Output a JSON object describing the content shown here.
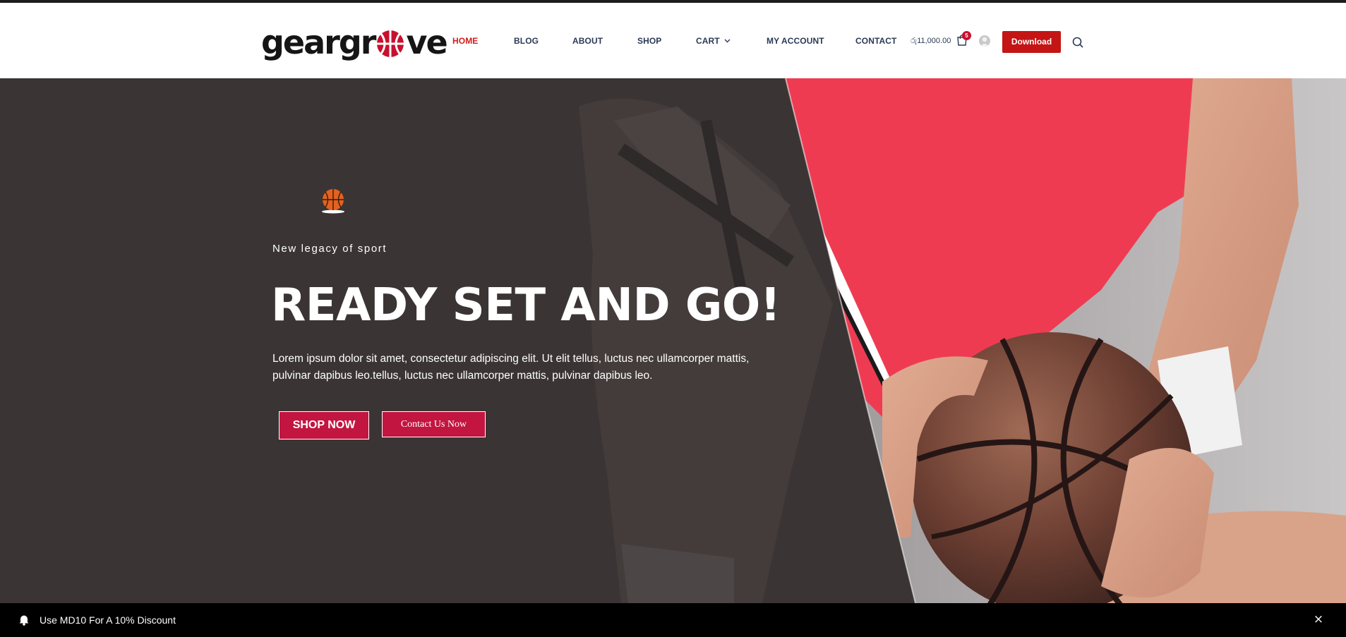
{
  "brand": {
    "logo_prefix": "geargr",
    "logo_suffix": "ve",
    "logo_full": "geargroove"
  },
  "nav": {
    "items": [
      {
        "label": "HOME",
        "active": true
      },
      {
        "label": "BLOG",
        "active": false
      },
      {
        "label": "ABOUT",
        "active": false
      },
      {
        "label": "SHOP",
        "active": false
      },
      {
        "label": "CART",
        "active": false,
        "has_dropdown": true
      },
      {
        "label": "MY ACCOUNT",
        "active": false
      },
      {
        "label": "CONTACT",
        "active": false
      }
    ]
  },
  "header": {
    "cart_total": "රු11,000.00",
    "cart_count": "5",
    "download_label": "Download",
    "icons": {
      "cart": "shopping-bag-icon",
      "avatar": "user-avatar",
      "search": "search-icon"
    }
  },
  "hero": {
    "tagline": "New legacy of sport",
    "headline": "READY SET AND GO!",
    "body": "Lorem ipsum dolor sit amet, consectetur adipiscing elit. Ut elit tellus, luctus nec ullamcorper mattis, pulvinar dapibus leo.tellus, luctus nec ullamcorper mattis, pulvinar dapibus leo.",
    "primary_button": "SHOP NOW",
    "secondary_button": "Contact Us Now",
    "icon": "basketball-icon"
  },
  "notice": {
    "text": "Use MD10 For A 10% Discount",
    "close": "×",
    "icon": "bell-icon"
  },
  "colors": {
    "accent_red": "#c41414",
    "active_nav": "#d31c1c",
    "button_crimson": "#c21540",
    "nav_text": "#2b3a55",
    "hero_dark": "#35302f",
    "notice_bg": "#000000"
  }
}
